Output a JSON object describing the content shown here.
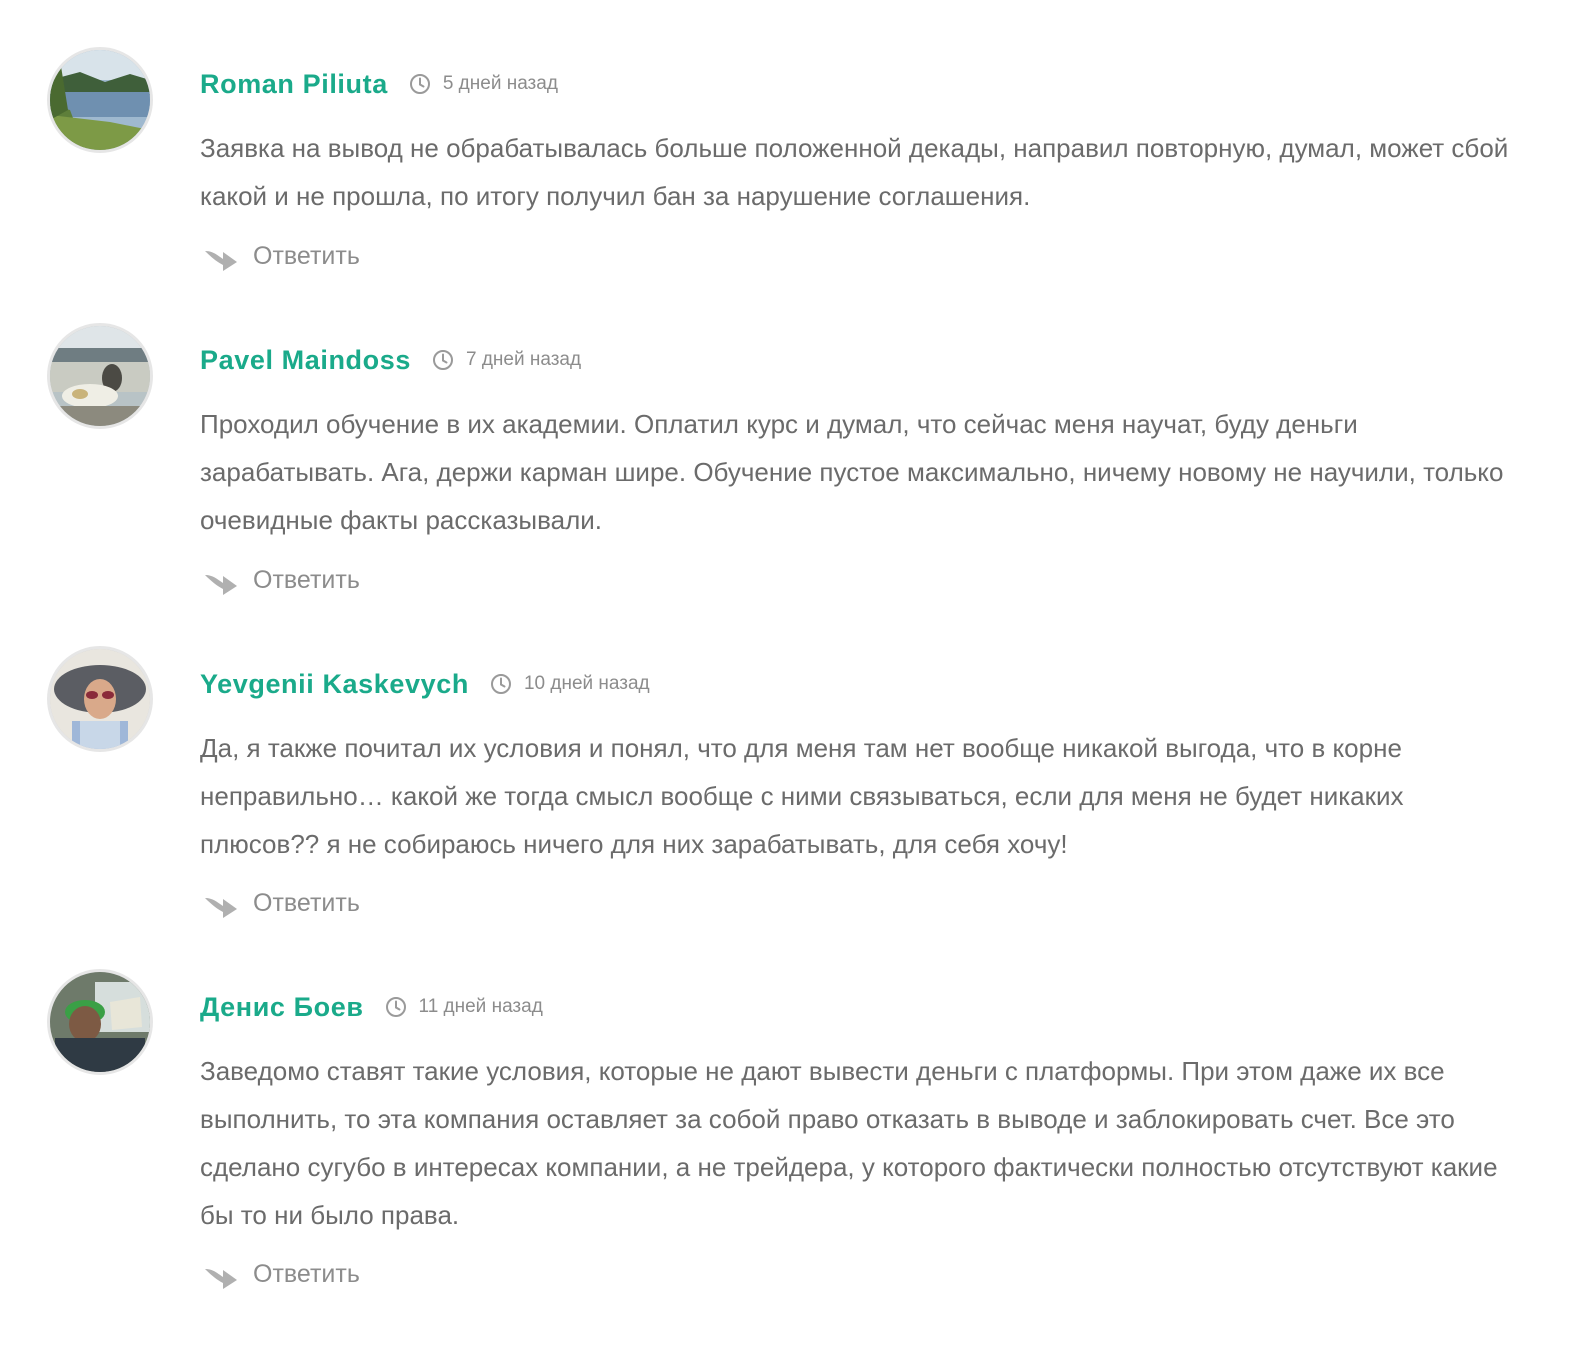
{
  "comments": [
    {
      "author": "Roman Piliuta",
      "time": "5 дней назад",
      "text": "Заявка на вывод не обрабатывалась больше положенной декады, направил повторную, думал, может сбой какой и не прошла, по итогу получил бан за нарушение соглашения.",
      "reply_label": "Ответить"
    },
    {
      "author": "Pavel Maindoss",
      "time": "7 дней назад",
      "text": "Проходил обучение в их академии. Оплатил курс и думал, что сейчас меня научат, буду деньги зарабатывать. Ага, держи карман шире. Обучение пустое максимально, ничему новому не научили, только очевидные факты рассказывали.",
      "reply_label": "Ответить"
    },
    {
      "author": "Yevgenii Kaskevych",
      "time": "10 дней назад",
      "text": "Да, я также почитал их условия и понял, что для меня там нет вообще никакой выгода, что в корне неправильно… какой же тогда смысл вообще с ними связываться, если для меня не будет никаких плюсов?? я не собираюсь ничего для них зарабатывать, для себя хочу!",
      "reply_label": "Ответить"
    },
    {
      "author": "Денис Боев",
      "time": "11 дней назад",
      "text": "Заведомо ставят такие условия, которые не дают вывести деньги с платформы. При этом даже их все выполнить, то эта компания оставляет за собой право отказать в выводе и заблокировать счет. Все это сделано сугубо в интересах компании, а не трейдера, у которого фактически полностью отсутствуют какие бы то ни было права.",
      "reply_label": "Ответить"
    }
  ],
  "icons": {
    "time": "clock-icon",
    "reply": "reply-arrow-icon"
  },
  "colors": {
    "author": "#1aaa8a",
    "meta": "#8c8c8c",
    "text": "#6b6b6b",
    "avatar_border": "#e6e6e6"
  }
}
